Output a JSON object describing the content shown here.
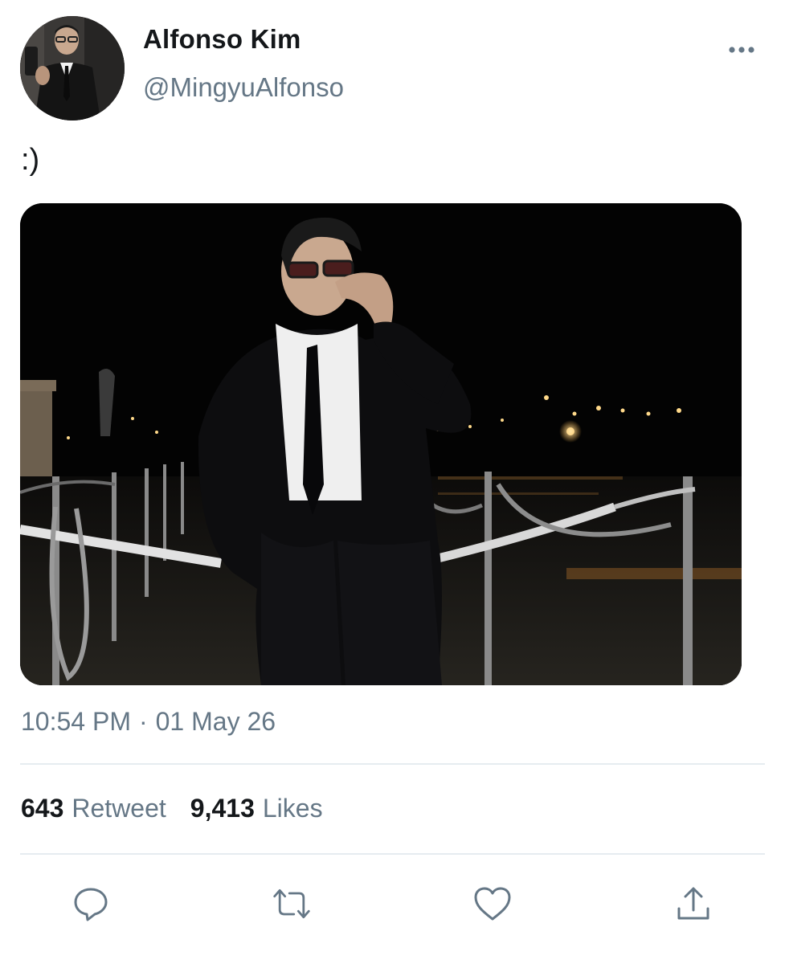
{
  "author": {
    "display_name": "Alfonso Kim",
    "handle": "@MingyuAlfonso",
    "avatar_icon": "profile-photo"
  },
  "tweet": {
    "text": ":)",
    "time": "10:54 PM",
    "separator": "·",
    "date": "01 May 26",
    "media_description": "photo of man in black suit and tie wearing glasses leaning on rope barrier at night"
  },
  "stats": {
    "retweets_count": "643",
    "retweets_label": "Retweet",
    "likes_count": "9,413",
    "likes_label": "Likes"
  },
  "actions": {
    "reply_icon": "comment-icon",
    "retweet_icon": "retweet-icon",
    "like_icon": "heart-icon",
    "share_icon": "share-icon"
  },
  "colors": {
    "text_primary": "#14171a",
    "text_secondary": "#657786",
    "icon": "#657786",
    "divider": "#e6ecf0"
  }
}
